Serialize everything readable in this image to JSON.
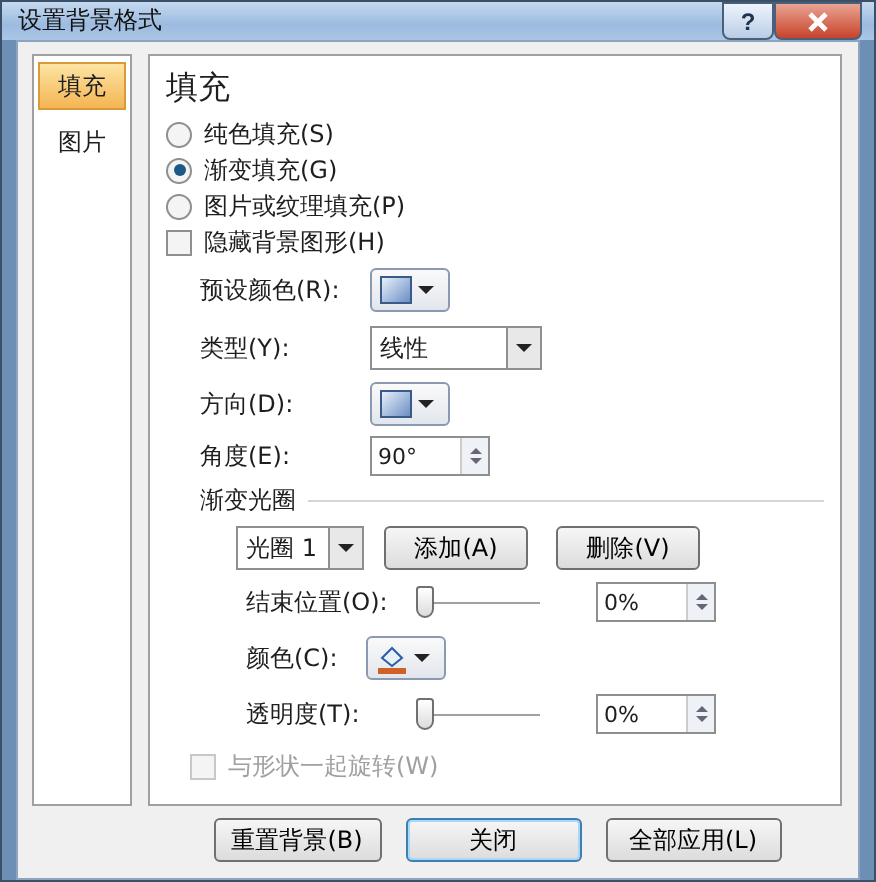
{
  "window": {
    "title": "设置背景格式",
    "help_label": "?"
  },
  "sidebar": {
    "items": [
      {
        "label": "填充",
        "selected": true
      },
      {
        "label": "图片",
        "selected": false
      }
    ]
  },
  "panel": {
    "title": "填充",
    "fill_options": [
      {
        "label": "纯色填充(S)",
        "selected": false
      },
      {
        "label": "渐变填充(G)",
        "selected": true
      },
      {
        "label": "图片或纹理填充(P)",
        "selected": false
      }
    ],
    "hide_background": {
      "label": "隐藏背景图形(H)",
      "checked": false
    },
    "preset_color": {
      "label": "预设颜色(R):"
    },
    "type": {
      "label": "类型(Y):",
      "value": "线性"
    },
    "direction": {
      "label": "方向(D):"
    },
    "angle": {
      "label": "角度(E):",
      "value": "90°"
    },
    "gradient_stops": {
      "title": "渐变光圈",
      "stop": "光圈 1",
      "add": "添加(A)",
      "remove": "删除(V)",
      "end_position": {
        "label": "结束位置(O):",
        "level": 0,
        "value": "0%"
      },
      "color": {
        "label": "颜色(C):"
      },
      "transparency": {
        "label": "透明度(T):",
        "level": 0,
        "value": "0%"
      }
    },
    "rotate": {
      "label": "与形状一起旋转(W)",
      "checked": false,
      "disabled": true
    }
  },
  "buttons": [
    "重置背景(B)",
    "关闭",
    "全部应用(L)"
  ]
}
